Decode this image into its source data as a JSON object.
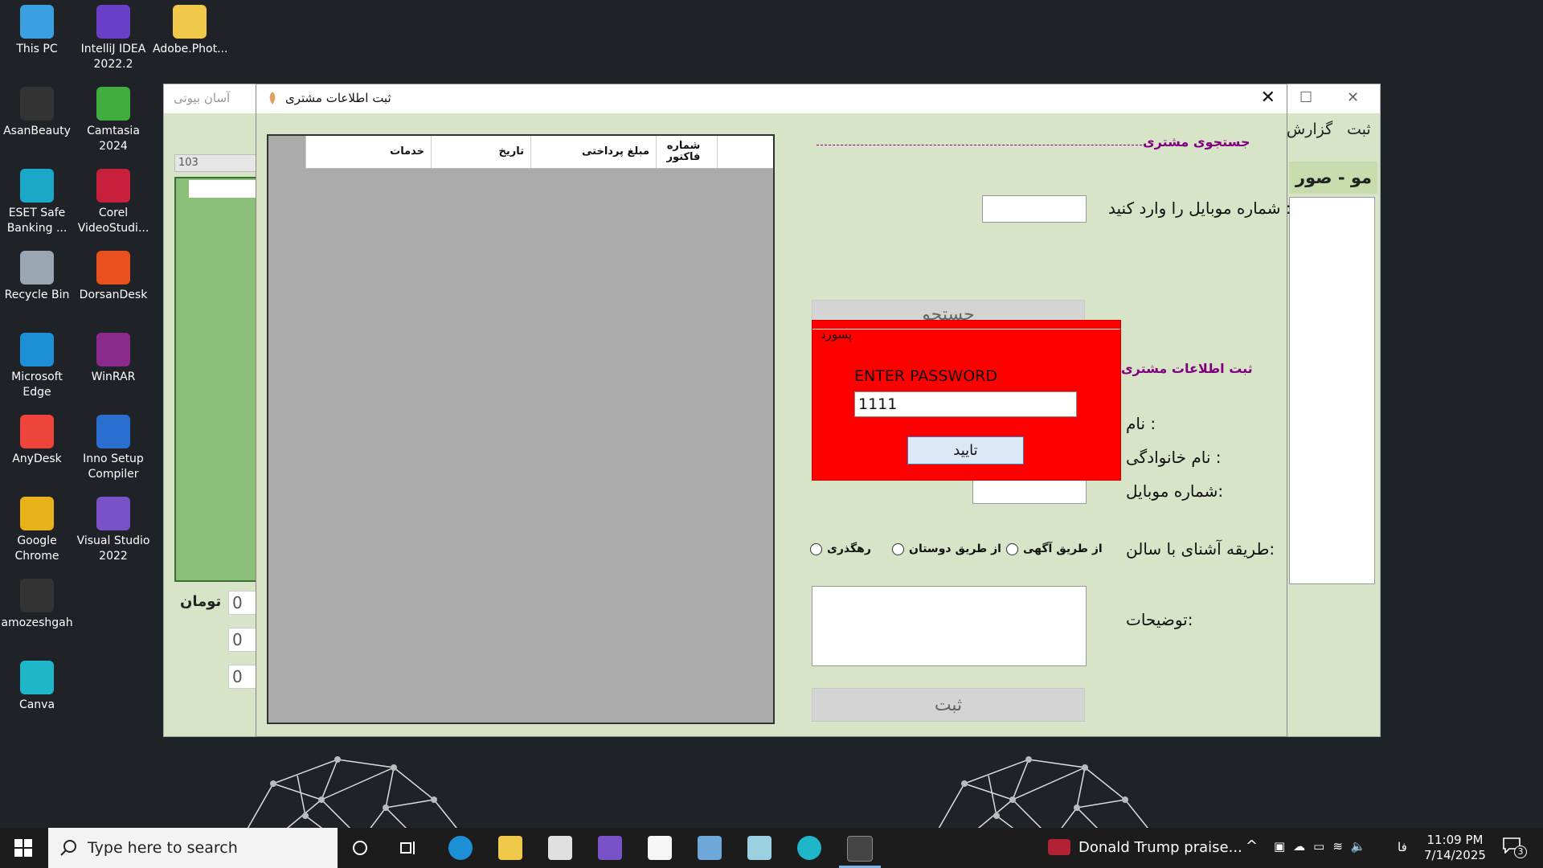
{
  "desktop": {
    "icons": [
      {
        "label": "This PC",
        "icon": "this-pc-icon",
        "color": "#3aa0e0"
      },
      {
        "label": "IntelliJ IDEA 2022.2",
        "icon": "intellij-icon",
        "color": "#6a3fc8"
      },
      {
        "label": "Adobe.Phot...",
        "icon": "folder-icon",
        "color": "#f0c84a"
      },
      {
        "label": "AsanBeauty",
        "icon": "app-shortcut-icon",
        "color": "#333333"
      },
      {
        "label": "Camtasia 2024",
        "icon": "camtasia-icon",
        "color": "#3fae3f"
      },
      {
        "label": "ESET Safe Banking ...",
        "icon": "eset-icon",
        "color": "#1aa7c8"
      },
      {
        "label": "Corel VideoStudi...",
        "icon": "corel-icon",
        "color": "#c8203c"
      },
      {
        "label": "Recycle Bin",
        "icon": "recycle-bin-icon",
        "color": "#9aa6b2"
      },
      {
        "label": "DorsanDesk",
        "icon": "dorsandesk-icon",
        "color": "#e8501e"
      },
      {
        "label": "Microsoft Edge",
        "icon": "edge-icon",
        "color": "#1d8fd6"
      },
      {
        "label": "WinRAR",
        "icon": "winrar-icon",
        "color": "#8a2a8a"
      },
      {
        "label": "AnyDesk",
        "icon": "anydesk-icon",
        "color": "#ef443b"
      },
      {
        "label": "Inno Setup Compiler",
        "icon": "inno-setup-icon",
        "color": "#2a6fd0"
      },
      {
        "label": "Google Chrome",
        "icon": "chrome-icon",
        "color": "#e8b21a"
      },
      {
        "label": "Visual Studio 2022",
        "icon": "visual-studio-icon",
        "color": "#7a52c8"
      },
      {
        "label": "amozeshgah",
        "icon": "app-shortcut-icon",
        "color": "#333333"
      },
      {
        "label": "Canva",
        "icon": "canva-icon",
        "color": "#1fb6c9"
      }
    ]
  },
  "bg_window": {
    "title": "آسان بیوتی",
    "menu_sabt": "ثبت",
    "menu_gozaresh": "گزارش",
    "field_value": "103",
    "right_header": "مو - صور",
    "toman": "تومان",
    "num1": "0",
    "num2": "0",
    "num3": "0"
  },
  "dialog": {
    "title": "ثبت اطلاعات مشتری",
    "close": "✕",
    "grid": {
      "columns": [
        "شماره فاکتور",
        "مبلغ پرداختی",
        "تاریخ",
        "خدمات"
      ]
    },
    "search_section": "جستجوی مشتری",
    "mobile_prompt": "شماره موبایل را وارد کنید  :",
    "search_button": "جستجو",
    "register_section": "ثبت اطلاعات مشتری",
    "name_label": "نام :",
    "family_label": "نام خانوادگی :",
    "mobile_label": "شماره موبایل:",
    "acquaint_label": "طریقه آشنای با سالن:",
    "radio_ad": "از طریق آگهی",
    "radio_friends": "از طریق دوستان",
    "radio_passing": "رهگذری",
    "notes_label": "توضیحات:",
    "save_button": "ثبت"
  },
  "password_popup": {
    "legend": "پسورد",
    "prompt": "ENTER PASSWORD",
    "value": "1111",
    "confirm": "تایید",
    "bg_color": "#ff0000"
  },
  "taskbar": {
    "search_placeholder": "Type here to search",
    "news": "Donald Trump praise...",
    "lang": "فا",
    "time": "11:09 PM",
    "date": "7/14/2025",
    "notif_count": "3"
  }
}
